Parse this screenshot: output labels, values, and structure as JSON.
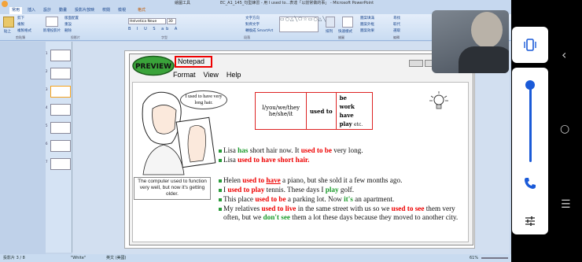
{
  "window": {
    "title": "EC_A1_145_句型練習 - 用 I used to...表達「以前常做的事」 - Microsoft PowerPoint",
    "contextual_tool": "繪圖工具"
  },
  "ribbon_tabs": [
    "常用",
    "插入",
    "設計",
    "動畫",
    "投影片放映",
    "校閱",
    "檢視",
    "格式"
  ],
  "ribbon": {
    "paste": "貼上",
    "cut": "剪下",
    "copy": "複製",
    "format_painter": "複製格式",
    "new_slide": "新增投影片",
    "layout": "版面配置",
    "reset": "重設",
    "delete": "刪除",
    "font_name": "Helvetica Neue",
    "font_size": "30",
    "text_direction": "文字方向",
    "align_text": "對齊文字",
    "convert_smartart": "轉換成 SmartArt",
    "arrange": "排列",
    "quick_styles": "快速樣式",
    "shape_fill": "圖案填滿",
    "shape_outline": "圖案外框",
    "shape_effects": "圖案效果",
    "find": "尋找",
    "replace": "取代",
    "select": "選取",
    "groups": [
      "剪貼簿",
      "投影片",
      "字型",
      "段落",
      "繪圖",
      "編輯"
    ]
  },
  "slides_pane": {
    "numbers": [
      "1",
      "2",
      "3",
      "4",
      "5",
      "6",
      "7",
      "8"
    ]
  },
  "slide": {
    "preview_badge": "PREVIEW",
    "notepad_label": "Notepad",
    "menu": [
      "Format",
      "View",
      "Help"
    ],
    "speech_bubble": "I used to have very long hair.",
    "caption": "The computer used to function very well, but now it's getting older.",
    "table": {
      "subjects": "I/you/we/they he/she/it",
      "used_to": "used to",
      "verbs": [
        "be",
        "work",
        "have",
        "play"
      ],
      "etc": "etc."
    },
    "bullets": [
      {
        "parts": [
          [
            "Lisa ",
            ""
          ],
          [
            "has",
            "g"
          ],
          [
            " short hair now. It ",
            ""
          ],
          [
            "used to be",
            "r"
          ],
          [
            " very long.",
            ""
          ]
        ]
      },
      {
        "parts": [
          [
            "Lisa ",
            ""
          ],
          [
            "used to have short hair.",
            "r"
          ]
        ]
      },
      {
        "parts": [
          [
            "Helen ",
            ""
          ],
          [
            "used to ",
            "r"
          ],
          [
            "have",
            "ru"
          ],
          [
            " a piano, but she sold it a few months ago.",
            ""
          ]
        ]
      },
      {
        "parts": [
          [
            "I ",
            ""
          ],
          [
            "used to play",
            "r"
          ],
          [
            " tennis. These days I ",
            ""
          ],
          [
            "play",
            "g"
          ],
          [
            " golf.",
            ""
          ]
        ]
      },
      {
        "parts": [
          [
            "This place ",
            ""
          ],
          [
            "used to be",
            "r"
          ],
          [
            " a parking lot. Now ",
            ""
          ],
          [
            "it's",
            "g"
          ],
          [
            " an apartment.",
            ""
          ]
        ]
      },
      {
        "parts": [
          [
            "My relatives ",
            ""
          ],
          [
            "used to live",
            "r"
          ],
          [
            " in the same street with us so we ",
            ""
          ],
          [
            "used to see",
            "r"
          ],
          [
            " them very often, but we ",
            ""
          ],
          [
            "don't see",
            "g"
          ],
          [
            " them a lot these days because they moved to another city.",
            ""
          ]
        ]
      }
    ]
  },
  "status": {
    "slide_info": "投影片 3 / 8",
    "theme": "\"White\"",
    "language": "英文 (美國)",
    "zoom": "61%"
  },
  "colors": {
    "accent_red": "#e00000",
    "accent_green": "#1a9a2a",
    "ribbon_blue": "#c6d8ef"
  }
}
